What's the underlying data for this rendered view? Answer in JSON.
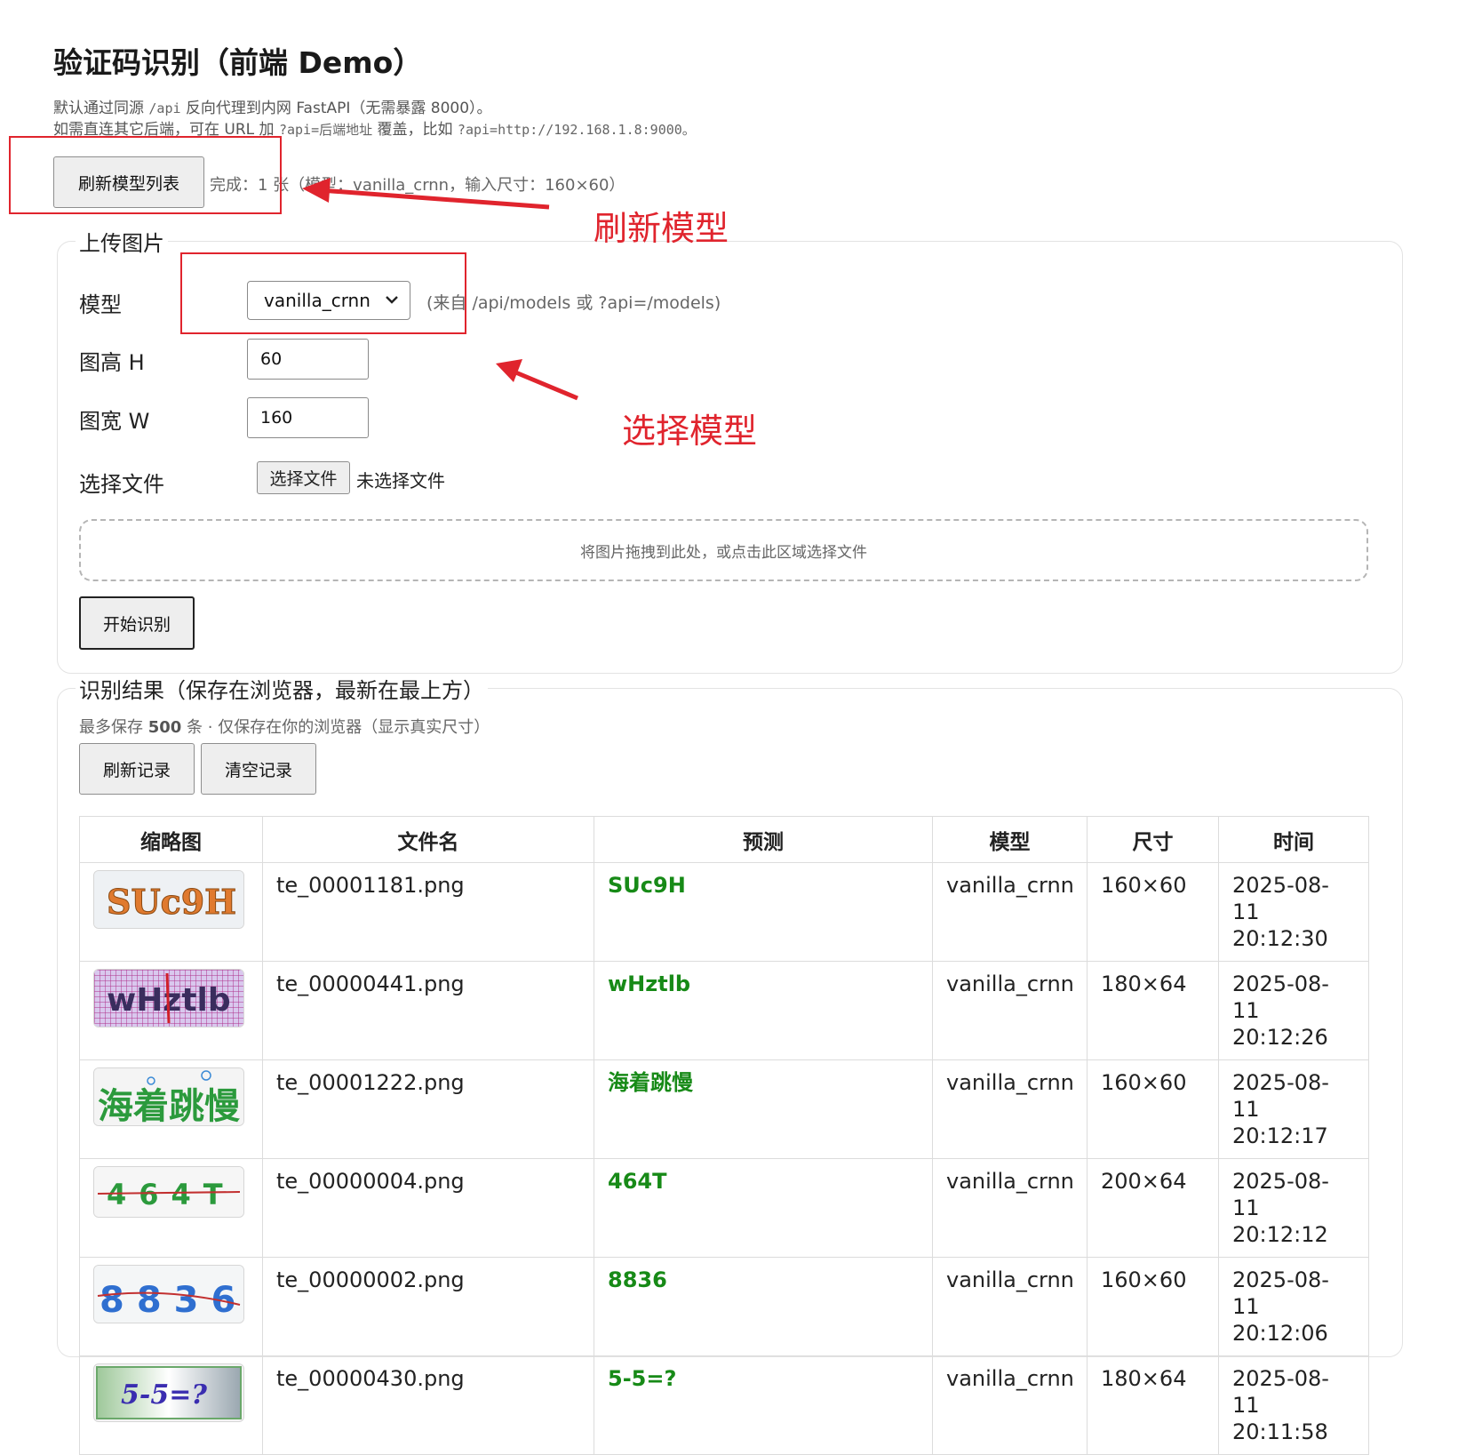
{
  "page": {
    "title": "验证码识别（前端 Demo）",
    "intro": {
      "l1_a": "默认通过同源",
      "l1_code": "/api",
      "l1_b": "反向代理到内网 FastAPI（无需暴露 8000）。",
      "l2_a": "如需直连其它后端，可在 URL 加",
      "l2_code1": "?api=后端地址",
      "l2_b": "覆盖，比如",
      "l2_code2": "?api=http://192.168.1.8:9000。"
    }
  },
  "toolbar": {
    "refresh_models_label": "刷新模型列表",
    "status_text": "完成：1 张（模型：vanilla_crnn，输入尺寸：160×60）"
  },
  "upload": {
    "legend": "上传图片",
    "model_label": "模型",
    "model_value": "vanilla_crnn",
    "model_hint": "(来自 /api/models 或 ?api=/models)",
    "height_label": "图高 H",
    "height_value": "60",
    "width_label": "图宽 W",
    "width_value": "160",
    "file_label": "选择文件",
    "file_button": "选择文件",
    "file_status": "未选择文件",
    "dropzone_text": "将图片拖拽到此处，或点击此区域选择文件",
    "start_button": "开始识别"
  },
  "results": {
    "legend": "识别结果（保存在浏览器，最新在最上方）",
    "note_a": "最多保存",
    "note_count": "500",
    "note_b": "条 · 仅保存在你的浏览器（显示真实尺寸）",
    "refresh_button": "刷新记录",
    "clear_button": "清空记录",
    "columns": [
      "缩略图",
      "文件名",
      "预测",
      "模型",
      "尺寸",
      "时间"
    ],
    "rows": [
      {
        "thumb_text": "SUc9H",
        "filename": "te_00001181.png",
        "prediction": "SUc9H",
        "model": "vanilla_crnn",
        "size": "160×60",
        "date": "2025-08-11",
        "time": "20:12:30"
      },
      {
        "thumb_text": "wHztlb",
        "filename": "te_00000441.png",
        "prediction": "wHztlb",
        "model": "vanilla_crnn",
        "size": "180×64",
        "date": "2025-08-11",
        "time": "20:12:26"
      },
      {
        "thumb_text": "海着跳慢",
        "filename": "te_00001222.png",
        "prediction": "海着跳慢",
        "model": "vanilla_crnn",
        "size": "160×60",
        "date": "2025-08-11",
        "time": "20:12:17"
      },
      {
        "thumb_text": "464T",
        "filename": "te_00000004.png",
        "prediction": "464T",
        "model": "vanilla_crnn",
        "size": "200×64",
        "date": "2025-08-11",
        "time": "20:12:12"
      },
      {
        "thumb_text": "8836",
        "filename": "te_00000002.png",
        "prediction": "8836",
        "model": "vanilla_crnn",
        "size": "160×60",
        "date": "2025-08-11",
        "time": "20:12:06"
      },
      {
        "thumb_text": "5-5=?",
        "filename": "te_00000430.png",
        "prediction": "5-5=?",
        "model": "vanilla_crnn",
        "size": "180×64",
        "date": "2025-08-11",
        "time": "20:11:58"
      }
    ]
  },
  "annotations": {
    "refresh_model": "刷新模型",
    "select_model": "选择模型",
    "color": "#e0242d"
  },
  "colors": {
    "prediction": "#178a17",
    "annotation": "#e0242d"
  }
}
